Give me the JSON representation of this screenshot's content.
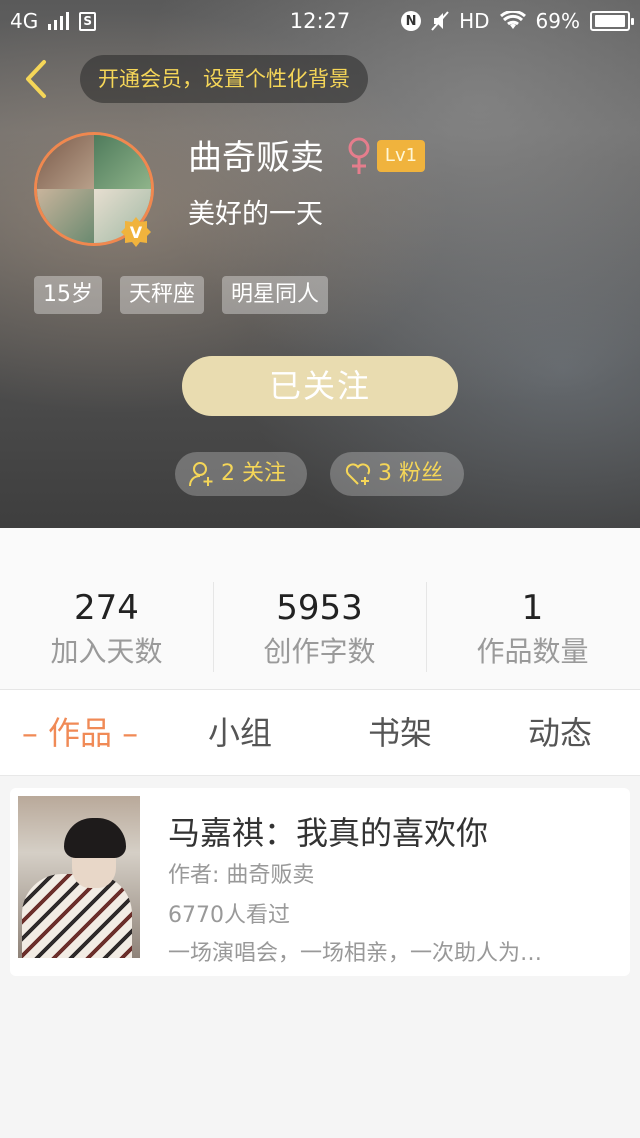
{
  "status_bar": {
    "network": "4G",
    "time": "12:27",
    "hd": "HD",
    "battery": "69%",
    "nfc_letter": "N"
  },
  "header": {
    "vip_prompt": "开通会员，设置个性化背景",
    "username": "曲奇贩卖",
    "gender_symbol": "♀",
    "level": "Lv1",
    "motto": "美好的一天",
    "badge_letter": "V",
    "tags": [
      "15岁",
      "天秤座",
      "明星同人"
    ],
    "follow_button": "已关注",
    "following_label": "2 关注",
    "fans_label": "3 粉丝"
  },
  "stats": [
    {
      "value": "274",
      "label": "加入天数"
    },
    {
      "value": "5953",
      "label": "创作字数"
    },
    {
      "value": "1",
      "label": "作品数量"
    }
  ],
  "tabs": [
    "– 作品 –",
    "小组",
    "书架",
    "动态"
  ],
  "active_tab": "– 作品 –",
  "book": {
    "title": "马嘉祺：我真的喜欢你",
    "author": "作者: 曲奇贩卖",
    "views": "6770人看过",
    "description": "一场演唱会，一场相亲，一次助人为…"
  },
  "colors": {
    "accent": "#f08a56",
    "gold": "#f5d658",
    "level_badge": "#f0b33d",
    "follow_button": "#e9dcb0"
  }
}
